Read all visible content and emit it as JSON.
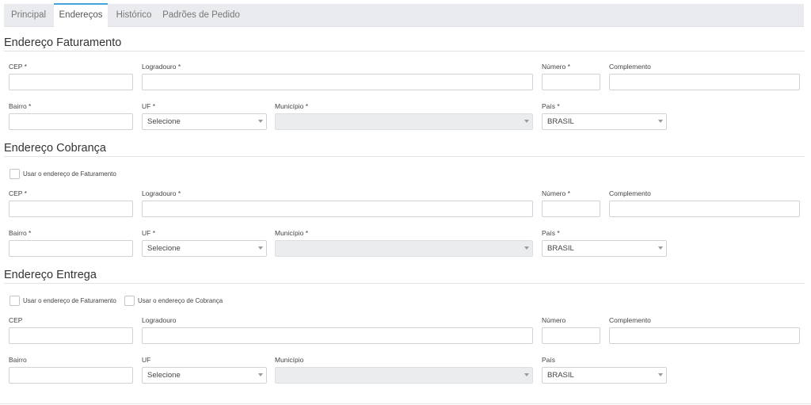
{
  "tabs": [
    {
      "label": "Principal"
    },
    {
      "label": "Endereços"
    },
    {
      "label": "Histórico"
    },
    {
      "label": "Padrões de Pedido"
    }
  ],
  "faturamento": {
    "title": "Endereço Faturamento",
    "cep_label": "CEP *",
    "logradouro_label": "Logradouro *",
    "numero_label": "Número *",
    "complemento_label": "Complemento",
    "bairro_label": "Bairro *",
    "uf_label": "UF *",
    "municipio_label": "Município *",
    "pais_label": "País *",
    "uf_value": "Selecione",
    "pais_value": "BRASIL"
  },
  "cobranca": {
    "title": "Endereço Cobrança",
    "check_faturamento": "Usar o endereço de Faturamento",
    "cep_label": "CEP *",
    "logradouro_label": "Logradouro *",
    "numero_label": "Número *",
    "complemento_label": "Complemento",
    "bairro_label": "Bairro *",
    "uf_label": "UF *",
    "municipio_label": "Município *",
    "pais_label": "País *",
    "uf_value": "Selecione",
    "pais_value": "BRASIL"
  },
  "entrega": {
    "title": "Endereço Entrega",
    "check_faturamento": "Usar o endereço de Faturamento",
    "check_cobranca": "Usar o endereço de Cobrança",
    "cep_label": "CEP",
    "logradouro_label": "Logradouro",
    "numero_label": "Número",
    "complemento_label": "Complemento",
    "bairro_label": "Bairro",
    "uf_label": "UF",
    "municipio_label": "Município",
    "pais_label": "País",
    "uf_value": "Selecione",
    "pais_value": "BRASIL"
  },
  "colors": {
    "active_tab_accent": "#41a6d9",
    "tabbar_bg": "#e9ebee",
    "disabled_select_bg": "#eaecee"
  }
}
